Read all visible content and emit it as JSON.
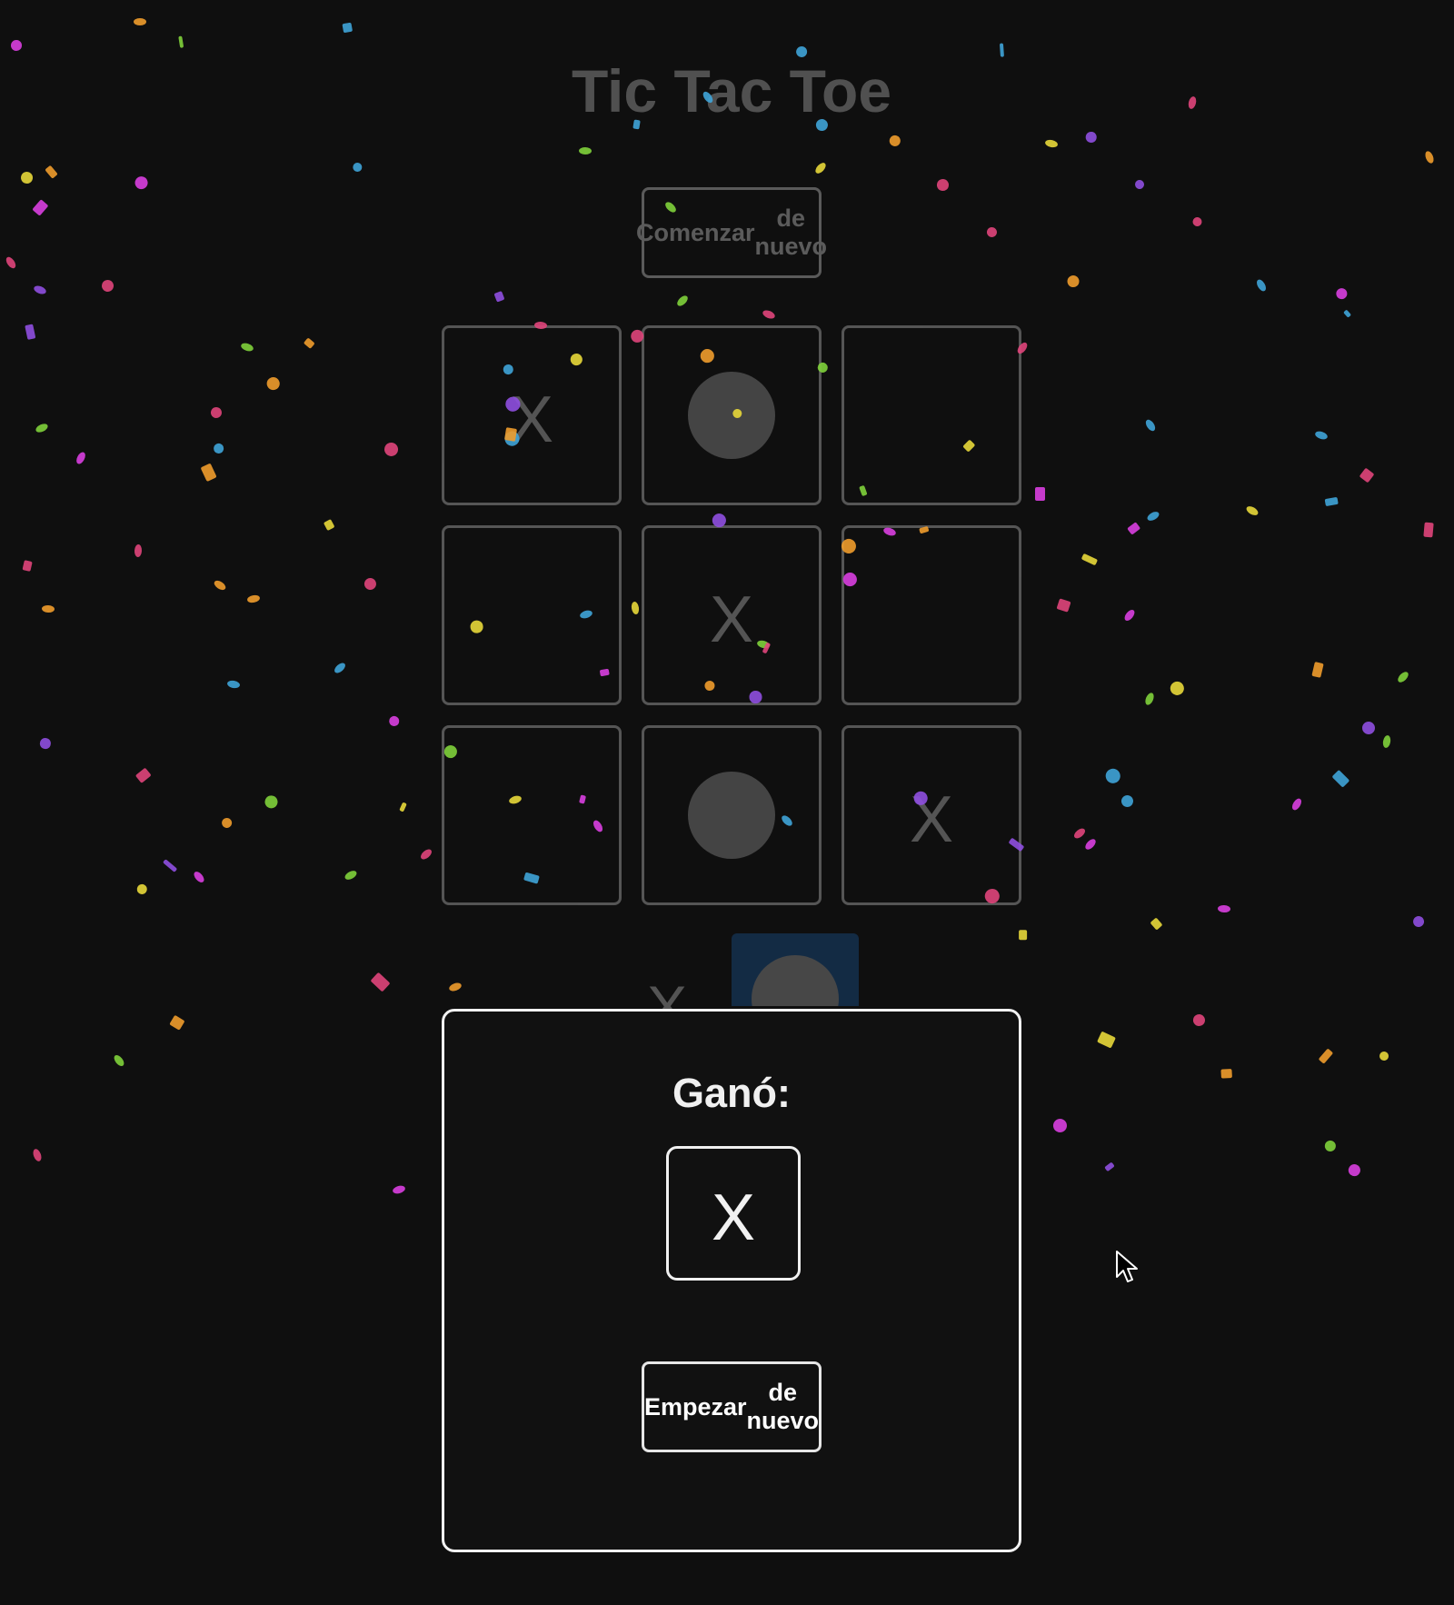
{
  "page": {
    "title": "Tic Tac Toe",
    "restart_line1": "Comenzar",
    "restart_line2": "de nuevo"
  },
  "board": {
    "cells": [
      "X",
      "O",
      "",
      "",
      "X",
      "",
      "",
      "O",
      "X"
    ]
  },
  "turn": {
    "x_label": "X",
    "active_player": "O"
  },
  "modal": {
    "title": "Ganó:",
    "winner": "X",
    "button_line1": "Empezar",
    "button_line2": "de nuevo"
  },
  "colors": {
    "background": "#0f0f0f",
    "border": "#f2f2f2",
    "turn_highlight": "#1c5fa8",
    "confetti": [
      "#e0457b",
      "#3fa4d8",
      "#7fd13b",
      "#f09c2c",
      "#8f4fe0",
      "#e8d83a",
      "#d93fe0"
    ]
  }
}
